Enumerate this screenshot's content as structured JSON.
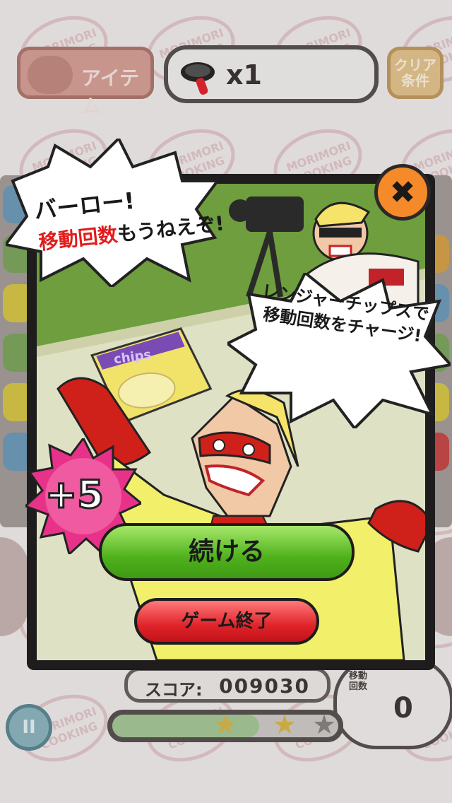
{
  "top_bar": {
    "item_label": "アイテム",
    "pan_count": "x1",
    "clear_label_line1": "クリア",
    "clear_label_line2": "条件"
  },
  "dialog": {
    "bubble_left_line1": "バーロー!",
    "bubble_left_red": "移動回数",
    "bubble_left_rest": "もうねえぞ!",
    "bubble_right": "レンジャーチップスで移動回数をチャージ!",
    "chips_brand": "chips",
    "bonus_badge": "+5",
    "continue_button": "続ける",
    "quit_button": "ゲーム終了",
    "close_glyph": "✖"
  },
  "bottom": {
    "score_label": "スコア:",
    "score_value": "009030",
    "moves_label": "移動回数",
    "moves_value": "0",
    "pause_glyph": "II",
    "progress_fraction": 0.65,
    "stars_filled": 2,
    "stars_total": 3
  },
  "background_logo": "MORIMORI COOKING",
  "colors": {
    "continue_green": "#4fb11c",
    "quit_red": "#e0242a",
    "badge_pink": "#e8328a",
    "close_orange": "#f58a2a",
    "hero_yellow": "#f2f06a",
    "hero_red": "#d0201a"
  }
}
